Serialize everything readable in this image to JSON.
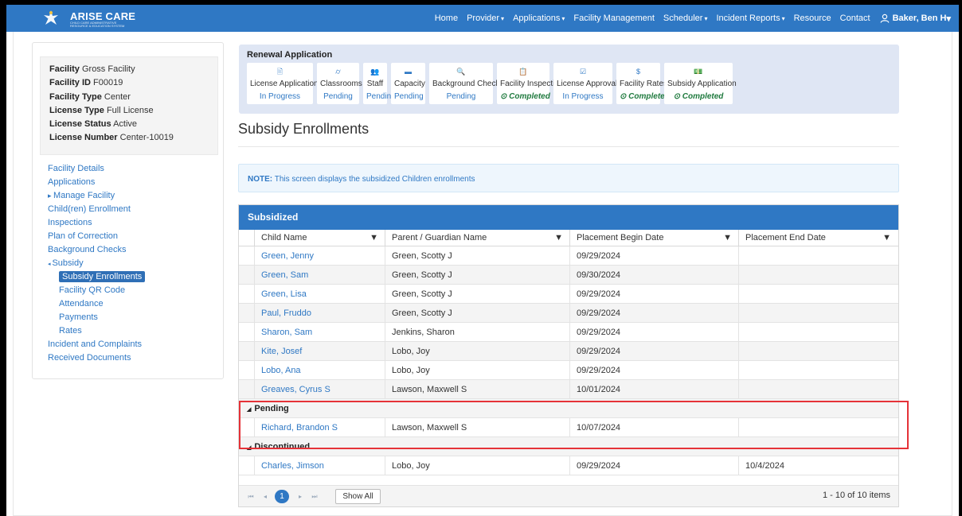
{
  "colors": {
    "primary": "#2f78c4",
    "highlight": "#e53238",
    "completed": "#1f7a3e"
  },
  "navbar": {
    "brand": "ARISE CARE",
    "tagline": "CHILD CARE ADMINISTRATIVE RESOURCE & EDUCATION SYSTEM",
    "items": [
      {
        "label": "Home",
        "caret": false
      },
      {
        "label": "Provider",
        "caret": true
      },
      {
        "label": "Applications",
        "caret": true
      },
      {
        "label": "Facility Management",
        "caret": false
      },
      {
        "label": "Scheduler",
        "caret": true
      },
      {
        "label": "Incident Reports",
        "caret": true
      },
      {
        "label": "Resource",
        "caret": false
      },
      {
        "label": "Contact",
        "caret": false
      }
    ],
    "user": "Baker, Ben H"
  },
  "facility": {
    "name_label": "Facility",
    "name": "Gross Facility",
    "id_label": "Facility ID",
    "id": "F00019",
    "type_label": "Facility Type",
    "type": "Center",
    "license_type_label": "License Type",
    "license_type": "Full License",
    "license_status_label": "License Status",
    "license_status": "Active",
    "license_number_label": "License Number",
    "license_number": "Center-10019"
  },
  "sidenav": [
    {
      "label": "Facility Details",
      "level": 1
    },
    {
      "label": "Applications",
      "level": 1
    },
    {
      "label": "Manage Facility",
      "level": 1,
      "expander": "collapsed"
    },
    {
      "label": "Child(ren) Enrollment",
      "level": 1
    },
    {
      "label": "Inspections",
      "level": 1
    },
    {
      "label": "Plan of Correction",
      "level": 1
    },
    {
      "label": "Background Checks",
      "level": 1
    },
    {
      "label": "Subsidy",
      "level": 1,
      "expander": "expanded"
    },
    {
      "label": "Subsidy Enrollments",
      "level": 2,
      "active": true
    },
    {
      "label": "Facility QR Code",
      "level": 2
    },
    {
      "label": "Attendance",
      "level": 2
    },
    {
      "label": "Payments",
      "level": 2
    },
    {
      "label": "Rates",
      "level": 2
    },
    {
      "label": "Incident and Complaints",
      "level": 1
    },
    {
      "label": "Received Documents",
      "level": 1
    }
  ],
  "renewal": {
    "title": "Renewal Application",
    "steps": [
      {
        "label": "License Application",
        "status": "In Progress",
        "completed": false,
        "icon": "document-icon",
        "glyph": "🖹"
      },
      {
        "label": "Classrooms",
        "status": "Pending",
        "completed": false,
        "icon": "chalkboard-icon",
        "glyph": "⌭"
      },
      {
        "label": "Staff",
        "status": "Pending",
        "completed": false,
        "icon": "users-icon",
        "glyph": "👥"
      },
      {
        "label": "Capacity",
        "status": "Pending",
        "completed": false,
        "icon": "minus-icon",
        "glyph": "▬"
      },
      {
        "label": "Background Checks",
        "status": "Pending",
        "completed": false,
        "icon": "search-icon",
        "glyph": "🔍"
      },
      {
        "label": "Facility Inspection",
        "status": "Completed",
        "completed": true,
        "icon": "clipboard-icon",
        "glyph": "📋"
      },
      {
        "label": "License Approval",
        "status": "In Progress",
        "completed": false,
        "icon": "check-square-icon",
        "glyph": "☑"
      },
      {
        "label": "Facility Rates",
        "status": "Completed",
        "completed": true,
        "icon": "dollar-icon",
        "glyph": "$"
      },
      {
        "label": "Subsidy Application",
        "status": "Completed",
        "completed": true,
        "icon": "money-icon",
        "glyph": "💵"
      }
    ]
  },
  "page": {
    "title": "Subsidy Enrollments",
    "note_label": "NOTE:",
    "note_text": "This screen displays the subsidized Children enrollments"
  },
  "grid": {
    "title": "Subsidized",
    "columns": [
      "Child Name",
      "Parent / Guardian Name",
      "Placement Begin Date",
      "Placement End Date"
    ],
    "rows": [
      [
        "Green, Jenny",
        "Green, Scotty J",
        "09/29/2024",
        ""
      ],
      [
        "Green, Sam",
        "Green, Scotty J",
        "09/30/2024",
        ""
      ],
      [
        "Green, Lisa",
        "Green, Scotty J",
        "09/29/2024",
        ""
      ],
      [
        "Paul, Fruddo",
        "Green, Scotty J",
        "09/29/2024",
        ""
      ],
      [
        "Sharon, Sam",
        "Jenkins, Sharon",
        "09/29/2024",
        ""
      ],
      [
        "Kite, Josef",
        "Lobo, Joy",
        "09/29/2024",
        ""
      ],
      [
        "Lobo, Ana",
        "Lobo, Joy",
        "09/29/2024",
        ""
      ],
      [
        "Greaves, Cyrus S",
        "Lawson, Maxwell S",
        "10/01/2024",
        ""
      ]
    ],
    "pending_label": "Pending",
    "pending_rows": [
      [
        "Richard, Brandon S",
        "Lawson, Maxwell S",
        "10/07/2024",
        ""
      ]
    ],
    "discontinued_label": "Discontinued",
    "discontinued_rows": [
      [
        "Charles, Jimson",
        "Lobo, Joy",
        "09/29/2024",
        "10/4/2024"
      ]
    ],
    "pager": {
      "current_page": "1",
      "show_all": "Show All",
      "info": "1 - 10 of 10 items"
    }
  }
}
